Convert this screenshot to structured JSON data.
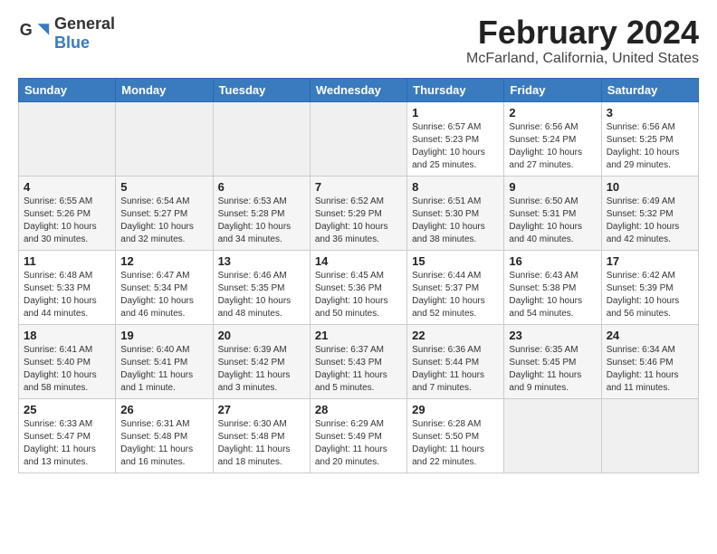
{
  "header": {
    "logo_general": "General",
    "logo_blue": "Blue",
    "title": "February 2024",
    "subtitle": "McFarland, California, United States"
  },
  "days_of_week": [
    "Sunday",
    "Monday",
    "Tuesday",
    "Wednesday",
    "Thursday",
    "Friday",
    "Saturday"
  ],
  "weeks": [
    [
      {
        "day": "",
        "info": ""
      },
      {
        "day": "",
        "info": ""
      },
      {
        "day": "",
        "info": ""
      },
      {
        "day": "",
        "info": ""
      },
      {
        "day": "1",
        "info": "Sunrise: 6:57 AM\nSunset: 5:23 PM\nDaylight: 10 hours\nand 25 minutes."
      },
      {
        "day": "2",
        "info": "Sunrise: 6:56 AM\nSunset: 5:24 PM\nDaylight: 10 hours\nand 27 minutes."
      },
      {
        "day": "3",
        "info": "Sunrise: 6:56 AM\nSunset: 5:25 PM\nDaylight: 10 hours\nand 29 minutes."
      }
    ],
    [
      {
        "day": "4",
        "info": "Sunrise: 6:55 AM\nSunset: 5:26 PM\nDaylight: 10 hours\nand 30 minutes."
      },
      {
        "day": "5",
        "info": "Sunrise: 6:54 AM\nSunset: 5:27 PM\nDaylight: 10 hours\nand 32 minutes."
      },
      {
        "day": "6",
        "info": "Sunrise: 6:53 AM\nSunset: 5:28 PM\nDaylight: 10 hours\nand 34 minutes."
      },
      {
        "day": "7",
        "info": "Sunrise: 6:52 AM\nSunset: 5:29 PM\nDaylight: 10 hours\nand 36 minutes."
      },
      {
        "day": "8",
        "info": "Sunrise: 6:51 AM\nSunset: 5:30 PM\nDaylight: 10 hours\nand 38 minutes."
      },
      {
        "day": "9",
        "info": "Sunrise: 6:50 AM\nSunset: 5:31 PM\nDaylight: 10 hours\nand 40 minutes."
      },
      {
        "day": "10",
        "info": "Sunrise: 6:49 AM\nSunset: 5:32 PM\nDaylight: 10 hours\nand 42 minutes."
      }
    ],
    [
      {
        "day": "11",
        "info": "Sunrise: 6:48 AM\nSunset: 5:33 PM\nDaylight: 10 hours\nand 44 minutes."
      },
      {
        "day": "12",
        "info": "Sunrise: 6:47 AM\nSunset: 5:34 PM\nDaylight: 10 hours\nand 46 minutes."
      },
      {
        "day": "13",
        "info": "Sunrise: 6:46 AM\nSunset: 5:35 PM\nDaylight: 10 hours\nand 48 minutes."
      },
      {
        "day": "14",
        "info": "Sunrise: 6:45 AM\nSunset: 5:36 PM\nDaylight: 10 hours\nand 50 minutes."
      },
      {
        "day": "15",
        "info": "Sunrise: 6:44 AM\nSunset: 5:37 PM\nDaylight: 10 hours\nand 52 minutes."
      },
      {
        "day": "16",
        "info": "Sunrise: 6:43 AM\nSunset: 5:38 PM\nDaylight: 10 hours\nand 54 minutes."
      },
      {
        "day": "17",
        "info": "Sunrise: 6:42 AM\nSunset: 5:39 PM\nDaylight: 10 hours\nand 56 minutes."
      }
    ],
    [
      {
        "day": "18",
        "info": "Sunrise: 6:41 AM\nSunset: 5:40 PM\nDaylight: 10 hours\nand 58 minutes."
      },
      {
        "day": "19",
        "info": "Sunrise: 6:40 AM\nSunset: 5:41 PM\nDaylight: 11 hours\nand 1 minute."
      },
      {
        "day": "20",
        "info": "Sunrise: 6:39 AM\nSunset: 5:42 PM\nDaylight: 11 hours\nand 3 minutes."
      },
      {
        "day": "21",
        "info": "Sunrise: 6:37 AM\nSunset: 5:43 PM\nDaylight: 11 hours\nand 5 minutes."
      },
      {
        "day": "22",
        "info": "Sunrise: 6:36 AM\nSunset: 5:44 PM\nDaylight: 11 hours\nand 7 minutes."
      },
      {
        "day": "23",
        "info": "Sunrise: 6:35 AM\nSunset: 5:45 PM\nDaylight: 11 hours\nand 9 minutes."
      },
      {
        "day": "24",
        "info": "Sunrise: 6:34 AM\nSunset: 5:46 PM\nDaylight: 11 hours\nand 11 minutes."
      }
    ],
    [
      {
        "day": "25",
        "info": "Sunrise: 6:33 AM\nSunset: 5:47 PM\nDaylight: 11 hours\nand 13 minutes."
      },
      {
        "day": "26",
        "info": "Sunrise: 6:31 AM\nSunset: 5:48 PM\nDaylight: 11 hours\nand 16 minutes."
      },
      {
        "day": "27",
        "info": "Sunrise: 6:30 AM\nSunset: 5:48 PM\nDaylight: 11 hours\nand 18 minutes."
      },
      {
        "day": "28",
        "info": "Sunrise: 6:29 AM\nSunset: 5:49 PM\nDaylight: 11 hours\nand 20 minutes."
      },
      {
        "day": "29",
        "info": "Sunrise: 6:28 AM\nSunset: 5:50 PM\nDaylight: 11 hours\nand 22 minutes."
      },
      {
        "day": "",
        "info": ""
      },
      {
        "day": "",
        "info": ""
      }
    ]
  ]
}
